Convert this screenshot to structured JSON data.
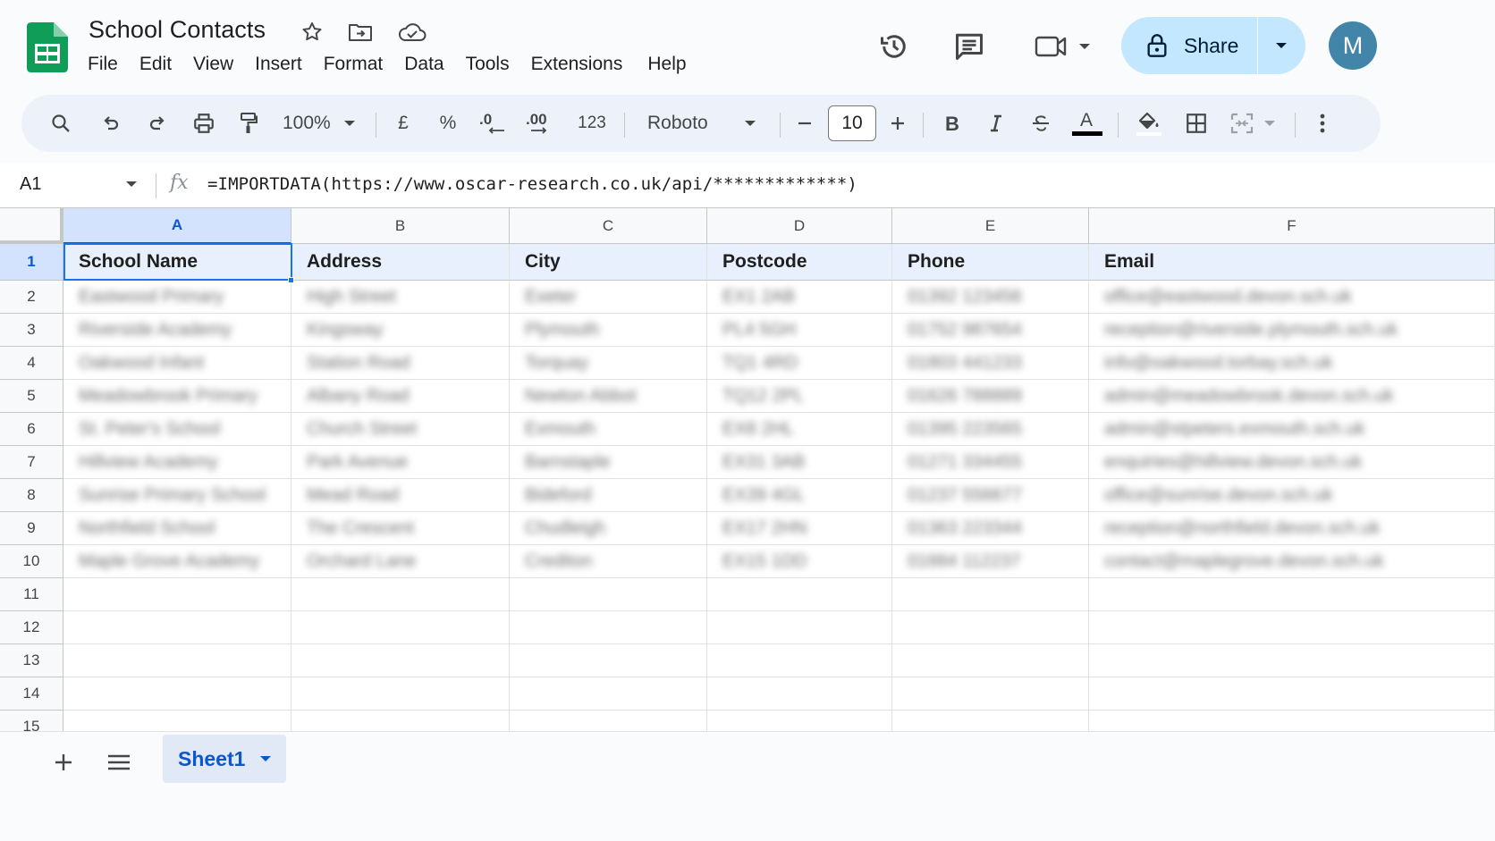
{
  "app": {
    "title": "School Contacts",
    "menu": [
      "File",
      "Edit",
      "View",
      "Insert",
      "Format",
      "Data",
      "Tools",
      "Extensions",
      "Help"
    ],
    "share_label": "Share",
    "avatar_initial": "M"
  },
  "toolbar": {
    "zoom": "100%",
    "currency": "£",
    "percent": "%",
    "number_format": "123",
    "font": "Roboto",
    "font_size": "10"
  },
  "formula_bar": {
    "cell_ref": "A1",
    "fx": "fx",
    "formula": "=IMPORTDATA(https://www.oscar-research.co.uk/api/*************)"
  },
  "sheet": {
    "columns": [
      "A",
      "B",
      "C",
      "D",
      "E",
      "F"
    ],
    "row_numbers": [
      "1",
      "2",
      "3",
      "4",
      "5",
      "6",
      "7",
      "8",
      "9",
      "10",
      "11",
      "12",
      "13",
      "14",
      "15"
    ],
    "headers": [
      "School Name",
      "Address",
      "City",
      "Postcode",
      "Phone",
      "Email"
    ],
    "rows": [
      [
        "Eastwood Primary",
        "High Street",
        "Exeter",
        "EX1 2AB",
        "01392 123456",
        "office@eastwood.devon.sch.uk"
      ],
      [
        "Riverside Academy",
        "Kingsway",
        "Plymouth",
        "PL4 5GH",
        "01752 987654",
        "reception@riverside.plymouth.sch.uk"
      ],
      [
        "Oakwood Infant",
        "Station Road",
        "Torquay",
        "TQ1 4RD",
        "01803 441233",
        "info@oakwood.torbay.sch.uk"
      ],
      [
        "Meadowbrook Primary",
        "Albany Road",
        "Newton Abbot",
        "TQ12 2PL",
        "01626 788889",
        "admin@meadowbrook.devon.sch.uk"
      ],
      [
        "St. Peter's School",
        "Church Street",
        "Exmouth",
        "EX8 2HL",
        "01395 223565",
        "admin@stpeters.exmouth.sch.uk"
      ],
      [
        "Hillview Academy",
        "Park Avenue",
        "Barnstaple",
        "EX31 3AB",
        "01271 334455",
        "enquiries@hillview.devon.sch.uk"
      ],
      [
        "Sunrise Primary School",
        "Mead Road",
        "Bideford",
        "EX39 4GL",
        "01237 556677",
        "office@sunrise.devon.sch.uk"
      ],
      [
        "Northfield School",
        "The Crescent",
        "Chudleigh",
        "EX17 2HN",
        "01363 223344",
        "reception@northfield.devon.sch.uk"
      ],
      [
        "Maple Grove Academy",
        "Orchard Lane",
        "Crediton",
        "EX15 1DD",
        "01884 112237",
        "contact@maplegrove.devon.sch.uk"
      ]
    ]
  },
  "tabs": {
    "active_sheet": "Sheet1"
  }
}
